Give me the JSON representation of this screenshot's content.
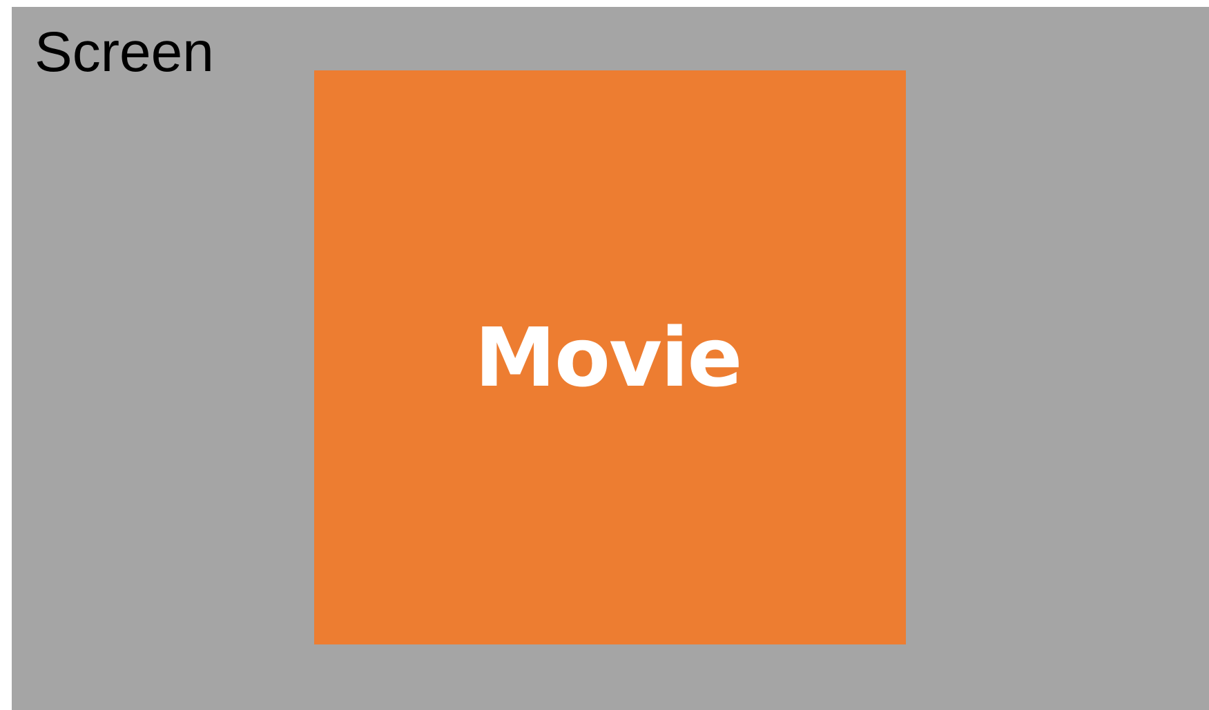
{
  "screen": {
    "label": "Screen",
    "color": "#a5a5a5"
  },
  "movie": {
    "label": "Movie",
    "color": "#ed7d31",
    "text_color": "#ffffff"
  }
}
